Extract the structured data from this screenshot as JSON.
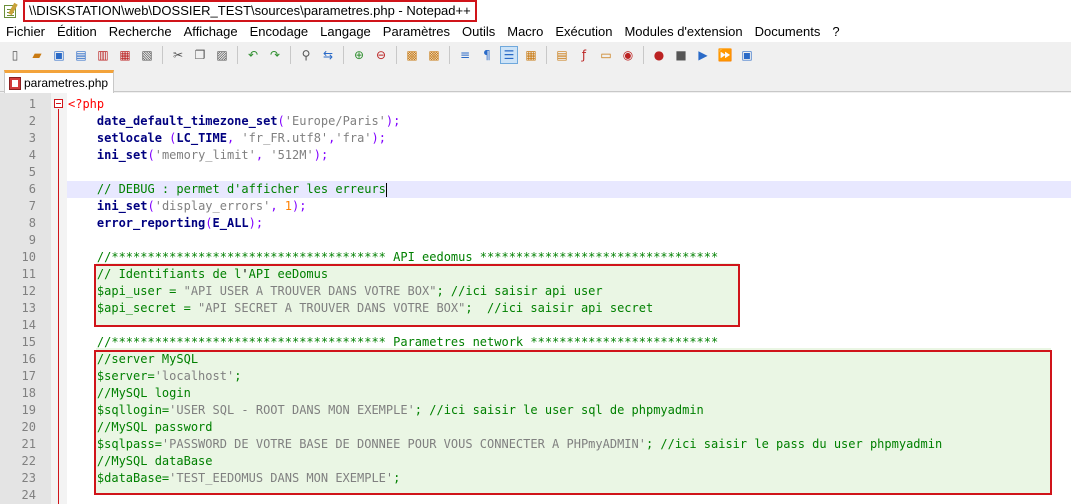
{
  "window": {
    "title": "\\\\DISKSTATION\\web\\DOSSIER_TEST\\sources\\parametres.php - Notepad++"
  },
  "menu": [
    "Fichier",
    "Édition",
    "Recherche",
    "Affichage",
    "Encodage",
    "Langage",
    "Paramètres",
    "Outils",
    "Macro",
    "Exécution",
    "Modules d'extension",
    "Documents",
    "?"
  ],
  "toolbar": {
    "icons": [
      "new-file-icon",
      "open-file-icon",
      "save-icon",
      "save-all-icon",
      "close-icon",
      "close-all-icon",
      "print-icon",
      "cut-icon",
      "copy-icon",
      "paste-icon",
      "undo-icon",
      "redo-icon",
      "find-icon",
      "replace-icon",
      "zoom-in-icon",
      "zoom-out-icon",
      "sync-vertical-icon",
      "sync-horizontal-icon",
      "word-wrap-icon",
      "show-all-chars-icon",
      "indent-guide-icon",
      "doc-map-icon",
      "function-list-icon",
      "folder-workspace-icon",
      "monitoring-icon",
      "record-macro-icon",
      "stop-macro-icon",
      "play-macro-icon",
      "play-multiple-icon",
      "save-macro-icon"
    ],
    "active_icon": "indent-guide-icon"
  },
  "tab": {
    "label": "parametres.php"
  },
  "editor": {
    "lines": [
      {
        "n": "1",
        "text": "<?php"
      },
      {
        "n": "2",
        "text": "    date_default_timezone_set('Europe/Paris');"
      },
      {
        "n": "3",
        "text": "    setlocale (LC_TIME, 'fr_FR.utf8','fra');"
      },
      {
        "n": "4",
        "text": "    ini_set('memory_limit', '512M');"
      },
      {
        "n": "5",
        "text": ""
      },
      {
        "n": "6",
        "text": "    // DEBUG : permet d'afficher les erreurs"
      },
      {
        "n": "7",
        "text": "    ini_set('display_errors', 1);"
      },
      {
        "n": "8",
        "text": "    error_reporting(E_ALL);"
      },
      {
        "n": "9",
        "text": ""
      },
      {
        "n": "10",
        "text": "    //************************************** API eedomus *********************************"
      },
      {
        "n": "11",
        "text": "    // Identifiants de l'API eeDomus"
      },
      {
        "n": "12",
        "text": "    $api_user = \"API USER A TROUVER DANS VOTRE BOX\"; //ici saisir api user"
      },
      {
        "n": "13",
        "text": "    $api_secret = \"API SECRET A TROUVER DANS VOTRE BOX\";  //ici saisir api secret"
      },
      {
        "n": "14",
        "text": ""
      },
      {
        "n": "15",
        "text": "    //************************************** Parametres network **************************"
      },
      {
        "n": "16",
        "text": "    //server MySQL"
      },
      {
        "n": "17",
        "text": "    $server='localhost';"
      },
      {
        "n": "18",
        "text": "    //MySQL login"
      },
      {
        "n": "19",
        "text": "    $sqllogin='USER SQL - ROOT DANS MON EXEMPLE'; //ici saisir le user sql de phpmyadmin"
      },
      {
        "n": "20",
        "text": "    //MySQL password"
      },
      {
        "n": "21",
        "text": "    $sqlpass='PASSWORD DE VOTRE BASE DE DONNEE POUR VOUS CONNECTER A PHPmyADMIN'; //ici saisir le pass du user phpmyadmin"
      },
      {
        "n": "22",
        "text": "    //MySQL dataBase"
      },
      {
        "n": "23",
        "text": "    $dataBase='TEST_EEDOMUS DANS MON EXEMPLE';"
      },
      {
        "n": "24",
        "text": ""
      }
    ],
    "current_line": "6"
  },
  "colors": {
    "highlight_border": "#d0141a",
    "comment": "#008000",
    "function": "#000080",
    "string": "#808080",
    "keyword": "#ff0000",
    "tab_accent": "#f3a33b"
  }
}
